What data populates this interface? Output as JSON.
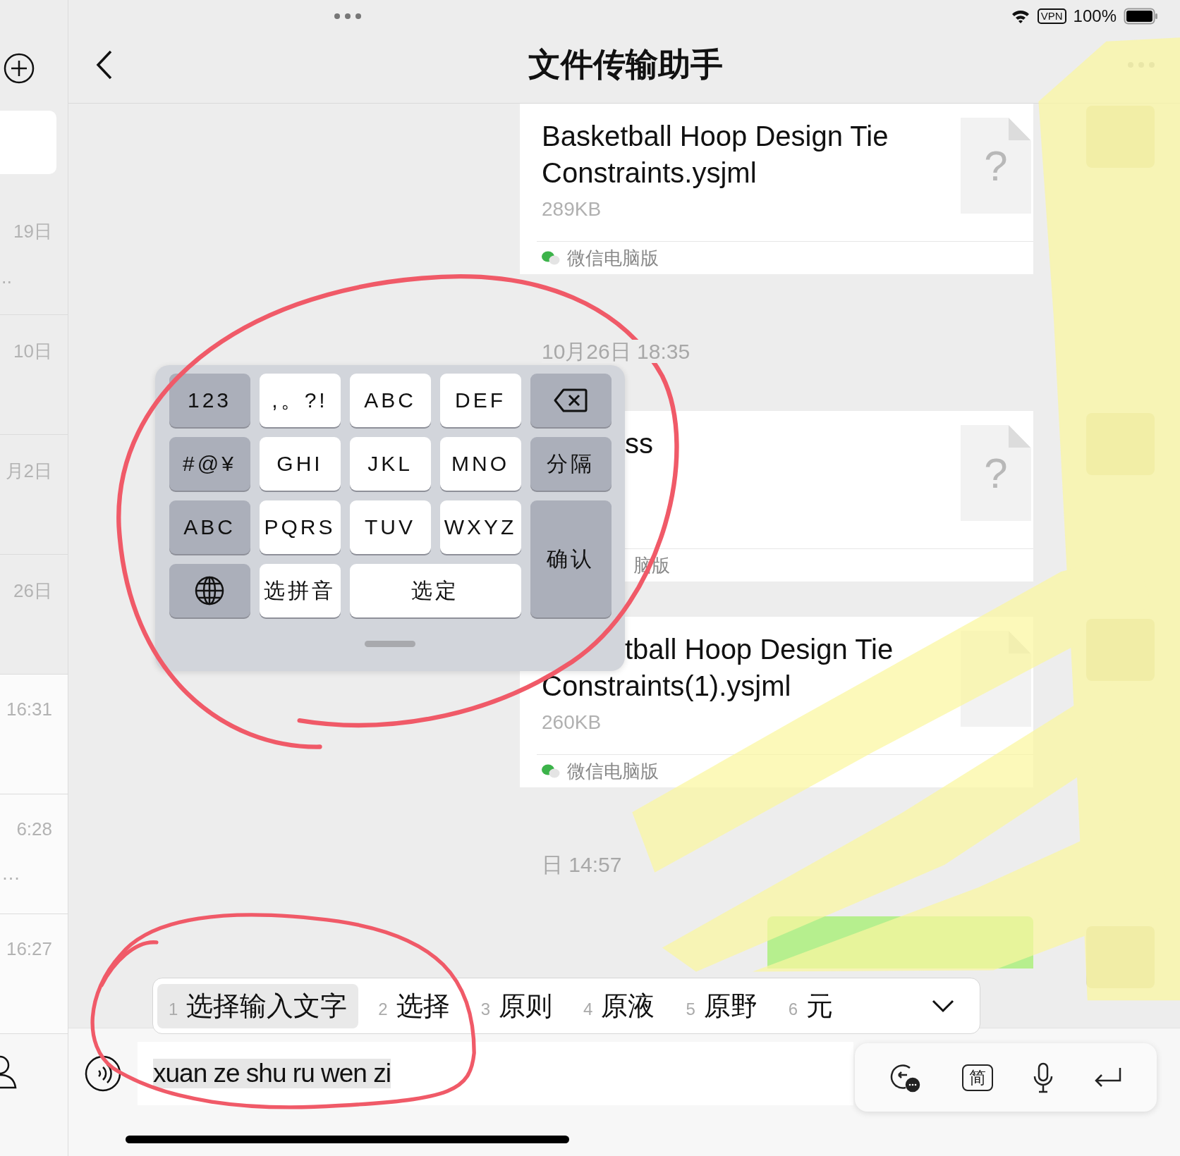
{
  "status_bar": {
    "vpn": "VPN",
    "battery": "100%"
  },
  "nav": {
    "title": "文件传输助手"
  },
  "sidebar": {
    "rows": [
      {
        "time": "19日",
        "preview": "..",
        "pinned": true
      },
      {
        "time": "10日",
        "pinned": true
      },
      {
        "time": "月2日",
        "pinned": true
      },
      {
        "time": "26日",
        "pinned": true
      },
      {
        "time": "16:31",
        "pinned": false
      },
      {
        "time": "6:28",
        "preview": "…",
        "pinned": false
      },
      {
        "time": "16:27",
        "pinned": false
      }
    ]
  },
  "messages": [
    {
      "kind": "file",
      "title_lines": [
        {
          "text": "Basketball Hoop Design Tie",
          "covered": false
        },
        {
          "text": "Constraints.ysjml",
          "covered": false
        }
      ],
      "size": "289KB",
      "file_glyph": "?",
      "source": "微信电脑版",
      "source_covered": false
    },
    {
      "kind": "time",
      "text": "10月26日 18:35"
    },
    {
      "kind": "file",
      "title_lines": [
        {
          "text": "ss",
          "covered": true
        }
      ],
      "file_glyph": "?",
      "source": "脑版",
      "source_covered": true
    },
    {
      "kind": "file",
      "title_lines": [
        {
          "text": "tball Hoop Design Tie",
          "covered": true
        },
        {
          "text": "Constraints(1).ysjml",
          "covered": false
        }
      ],
      "size": "260KB",
      "source": "微信电脑版",
      "source_covered": false
    },
    {
      "kind": "time",
      "text": "日 14:57"
    },
    {
      "kind": "bubble"
    }
  ],
  "keyboard": {
    "keys": [
      {
        "kind": "function",
        "label": "123"
      },
      {
        "kind": "letter",
        "label": ",。?!"
      },
      {
        "kind": "letter",
        "label": "ABC"
      },
      {
        "kind": "letter",
        "label": "DEF"
      },
      {
        "kind": "delete"
      },
      {
        "kind": "function",
        "label": "#@¥"
      },
      {
        "kind": "letter",
        "label": "GHI"
      },
      {
        "kind": "letter",
        "label": "JKL"
      },
      {
        "kind": "letter",
        "label": "MNO"
      },
      {
        "kind": "function",
        "label": "分隔"
      },
      {
        "kind": "function",
        "label": "ABC"
      },
      {
        "kind": "letter",
        "label": "PQRS"
      },
      {
        "kind": "letter",
        "label": "TUV"
      },
      {
        "kind": "letter",
        "label": "WXYZ"
      },
      {
        "kind": "function",
        "label": "确认",
        "tall": true
      },
      {
        "kind": "globe"
      },
      {
        "kind": "letter",
        "label": "选拼音"
      },
      {
        "kind": "letter",
        "label": "选定",
        "wide": true
      }
    ]
  },
  "candidates": [
    {
      "number": "1",
      "text": "选择输入文字",
      "selected": true
    },
    {
      "number": "2",
      "text": "选择",
      "selected": false
    },
    {
      "number": "3",
      "text": "原则",
      "selected": false
    },
    {
      "number": "4",
      "text": "原液",
      "selected": false
    },
    {
      "number": "5",
      "text": "原野",
      "selected": false
    },
    {
      "number": "6",
      "text": "元",
      "selected": false
    }
  ],
  "input": {
    "value": "xuan ze shu ru wen zi"
  },
  "toolbar": {
    "simplified": "简"
  }
}
